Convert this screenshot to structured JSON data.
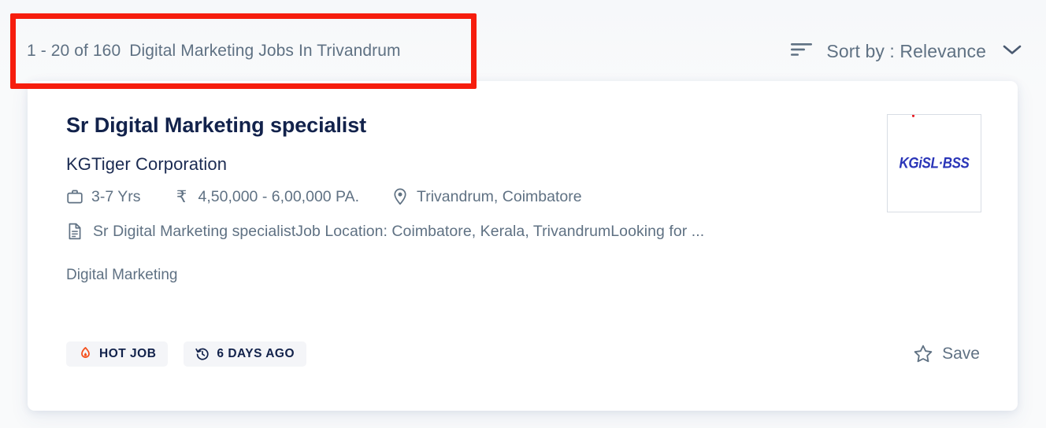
{
  "header": {
    "results_count": "1 - 20 of 160",
    "results_title": "Digital Marketing Jobs In Trivandrum",
    "sort": {
      "label": "Sort by : Relevance",
      "icon": "sort-lines-icon",
      "chevron": "chevron-down-icon"
    }
  },
  "annotation": {
    "color": "#f61d0d",
    "target": "results-header-text"
  },
  "job": {
    "title": "Sr Digital Marketing specialist",
    "company": "KGTiger Corporation",
    "meta": {
      "experience": "3-7 Yrs",
      "experience_icon": "briefcase-icon",
      "salary": "4,50,000 - 6,00,000 PA.",
      "salary_icon": "rupee-icon",
      "salary_symbol": "₹",
      "location": "Trivandrum, Coimbatore",
      "location_icon": "map-pin-icon"
    },
    "description": "Sr Digital Marketing specialistJob Location: Coimbatore, Kerala, TrivandrumLooking for ...",
    "description_icon": "document-icon",
    "skills": "Digital Marketing",
    "badges": [
      {
        "label": "HOT JOB",
        "icon": "flame-icon",
        "icon_color": "#f4511e"
      },
      {
        "label": "6 DAYS AGO",
        "icon": "history-clock-icon",
        "icon_color": "#12224b"
      }
    ],
    "save": {
      "label": "Save",
      "icon": "star-outline-icon"
    },
    "logo": {
      "text": "KGiSL·BSS",
      "primary_color": "#2a35b8",
      "accent_color": "#e8242a"
    }
  },
  "colors": {
    "page_background": "#f9fafb",
    "card_background": "#ffffff",
    "title_text": "#12224b",
    "body_text": "#5f7183",
    "annotation_red": "#f61d0d"
  }
}
